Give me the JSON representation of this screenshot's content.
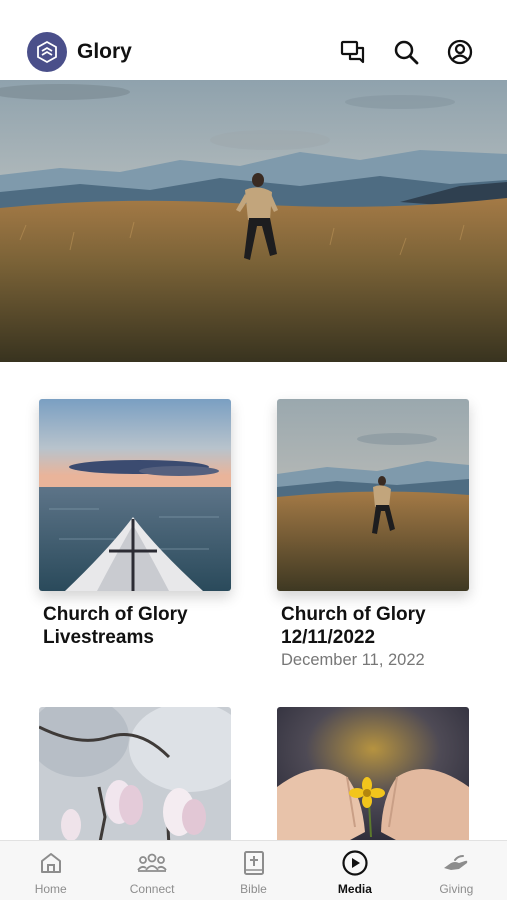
{
  "header": {
    "app_name": "Glory",
    "logo_icon": "church-logo-icon",
    "actions": [
      "messages-icon",
      "search-icon",
      "account-icon"
    ]
  },
  "hero": {
    "image": "person-running-across-grassy-mountain-meadow"
  },
  "media_items": [
    {
      "title": "Church of Glory Livestreams",
      "date": "",
      "image": "kayak-on-lake-at-sunset"
    },
    {
      "title": "Church of Glory 12/11/2022",
      "date": "December 11, 2022",
      "image": "person-running-across-grassy-mountain-meadow"
    },
    {
      "title": "",
      "date": "",
      "image": "white-magnolia-blossoms"
    },
    {
      "title": "",
      "date": "",
      "image": "hands-holding-yellow-flower"
    }
  ],
  "tabbar": {
    "active": "Media",
    "tabs": [
      {
        "label": "Home",
        "icon": "home-icon"
      },
      {
        "label": "Connect",
        "icon": "people-icon"
      },
      {
        "label": "Bible",
        "icon": "bible-icon"
      },
      {
        "label": "Media",
        "icon": "play-circle-icon"
      },
      {
        "label": "Giving",
        "icon": "giving-hand-icon"
      }
    ]
  },
  "colors": {
    "logo_background": "#4a4f8a",
    "inactive_tab": "#8d8d8d",
    "date_text": "#777777"
  }
}
